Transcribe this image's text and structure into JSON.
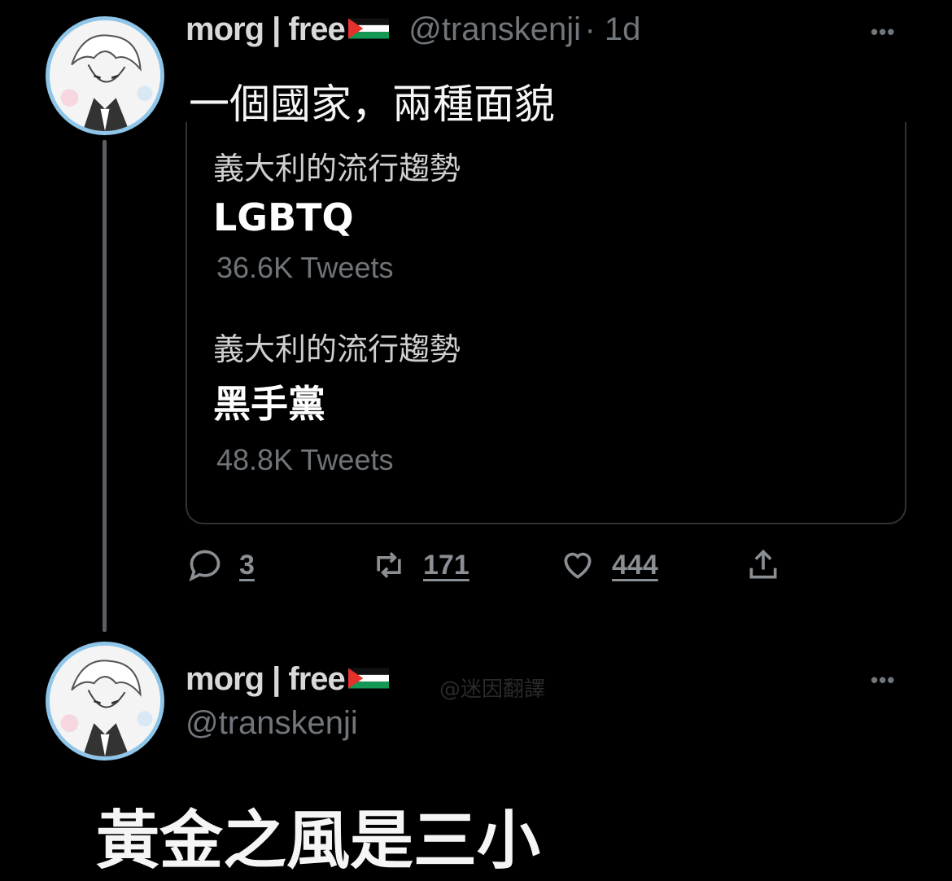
{
  "tweet1": {
    "display_name": "morg | free",
    "handle": "@transkenji",
    "time": "· 1d",
    "more": "•••",
    "text": "一個國家，兩種面貌",
    "trends": [
      {
        "label": "義大利的流行趨勢",
        "title": "LGBTQ",
        "count": "36.6K Tweets"
      },
      {
        "label": "義大利的流行趨勢",
        "title": "黑手黨",
        "count": "48.8K Tweets"
      }
    ],
    "actions": {
      "replies": "3",
      "retweets": "171",
      "likes": "444"
    }
  },
  "tweet2": {
    "display_name": "morg | free",
    "handle": "@transkenji",
    "more": "•••",
    "watermark": "@迷因翻譯",
    "text": "黃金之風是三小"
  },
  "colors": {
    "background": "#000000",
    "secondary_text": "#71767b",
    "avatar_ring": "#8ec5e8"
  }
}
